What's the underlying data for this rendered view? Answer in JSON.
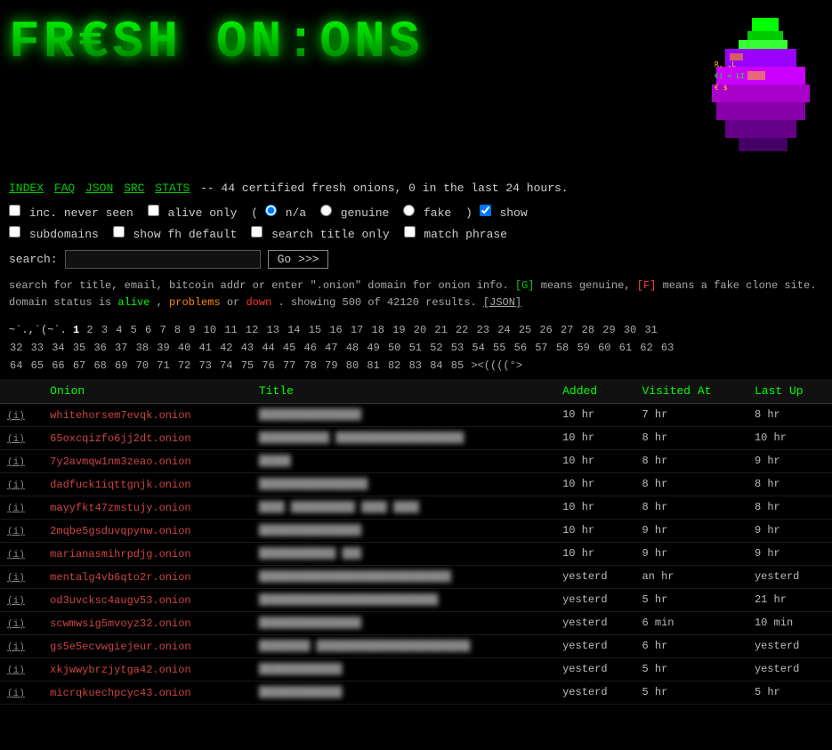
{
  "header": {
    "logo_text": "FR€SH ON:ONS",
    "nav": {
      "items": [
        {
          "label": "INDEX",
          "url": "#"
        },
        {
          "label": "FAQ",
          "url": "#"
        },
        {
          "label": "JSON",
          "url": "#"
        },
        {
          "label": "SRC",
          "url": "#"
        },
        {
          "label": "STATS",
          "url": "#"
        }
      ],
      "description": "-- 44 certified fresh onions, 0 in the last 24 hours."
    }
  },
  "options": {
    "inc_never_seen": {
      "label": "inc. never seen",
      "checked": false
    },
    "alive_only": {
      "label": "alive only",
      "checked": false
    },
    "radio_na": {
      "label": "n/a",
      "value": "na"
    },
    "radio_genuine": {
      "label": "genuine",
      "value": "genuine"
    },
    "radio_fake": {
      "label": "fake",
      "value": "fake"
    },
    "show": {
      "label": "show",
      "checked": true
    },
    "subdomains": {
      "label": "subdomains",
      "checked": false
    },
    "show_fh_default": {
      "label": "show fh default",
      "checked": false
    },
    "search_title_only": {
      "label": "search title only",
      "checked": false
    },
    "match_phrase": {
      "label": "match phrase",
      "checked": false
    }
  },
  "search": {
    "label": "search:",
    "placeholder": "",
    "button_label": "Go >>>"
  },
  "info": {
    "line1": "search for title, email, bitcoin addr or enter \".onion\" domain for onion info.",
    "genuine_marker": "[G]",
    "genuine_desc": "means genuine,",
    "fake_marker": "[F]",
    "fake_desc": "means a fake clone site. domain status is",
    "alive": "alive",
    "problems": "problems",
    "or": "or",
    "down": "down",
    "showing": ". showing 500 of 42120 results.",
    "json_link": "[JSON]"
  },
  "pagination": {
    "smile": "~`.,`(~`.",
    "current": "1",
    "pages": [
      "2",
      "3",
      "4",
      "5",
      "6",
      "7",
      "8",
      "9",
      "10",
      "11",
      "12",
      "13",
      "14",
      "15",
      "16",
      "17",
      "18",
      "19",
      "20",
      "21",
      "22",
      "23",
      "24",
      "25",
      "26",
      "27",
      "28",
      "29",
      "30",
      "31",
      "32",
      "33",
      "34",
      "35",
      "36",
      "37",
      "38",
      "39",
      "40",
      "41",
      "42",
      "43",
      "44",
      "45",
      "46",
      "47",
      "48",
      "49",
      "50",
      "51",
      "52",
      "53",
      "54",
      "55",
      "56",
      "57",
      "58",
      "59",
      "60",
      "61",
      "62",
      "63",
      "64",
      "65",
      "66",
      "67",
      "68",
      "69",
      "70",
      "71",
      "72",
      "73",
      "74",
      "75",
      "76",
      "77",
      "78",
      "79",
      "80",
      "81",
      "82",
      "83",
      "84",
      "85"
    ],
    "end_symbol": "><(((°>"
  },
  "table": {
    "headers": [
      "",
      "Onion",
      "Title",
      "Added",
      "Visited At",
      "Last Up"
    ],
    "rows": [
      {
        "i": "(i)",
        "onion": "whitehorsem7evqk.onion",
        "title": "",
        "added": "10 hr",
        "visited": "7 hr",
        "last_up": "8 hr",
        "blurred": true
      },
      {
        "i": "(i)",
        "onion": "65oxcqizfo6jj2dt.onion",
        "title": "",
        "added": "10 hr",
        "visited": "8 hr",
        "last_up": "10 hr",
        "blurred": true
      },
      {
        "i": "(i)",
        "onion": "7y2avmqw1nm3zeao.onion",
        "title": "",
        "added": "10 hr",
        "visited": "8 hr",
        "last_up": "9 hr",
        "blurred": true
      },
      {
        "i": "(i)",
        "onion": "dadfuck1iqttgnjk.onion",
        "title": "",
        "added": "10 hr",
        "visited": "8 hr",
        "last_up": "8 hr",
        "blurred": true
      },
      {
        "i": "(i)",
        "onion": "mayyfkt47zmstujy.onion",
        "title": "",
        "added": "10 hr",
        "visited": "8 hr",
        "last_up": "8 hr",
        "blurred": true
      },
      {
        "i": "(i)",
        "onion": "2mqbe5gsduvqpynw.onion",
        "title": "",
        "added": "10 hr",
        "visited": "9 hr",
        "last_up": "9 hr",
        "blurred": true
      },
      {
        "i": "(i)",
        "onion": "marianasmihrpdjg.onion",
        "title": "",
        "added": "10 hr",
        "visited": "9 hr",
        "last_up": "9 hr",
        "blurred": true
      },
      {
        "i": "(i)",
        "onion": "mentalg4vb6qto2r.onion",
        "title": "",
        "added": "yesterd",
        "visited": "an hr",
        "last_up": "yesterd",
        "blurred": true
      },
      {
        "i": "(i)",
        "onion": "od3uvcksc4augv53.onion",
        "title": "",
        "added": "yesterd",
        "visited": "5 hr",
        "last_up": "21 hr",
        "blurred": true
      },
      {
        "i": "(i)",
        "onion": "scwmwsig5mvoyz32.onion",
        "title": "",
        "added": "yesterd",
        "visited": "6 min",
        "last_up": "10 min",
        "blurred": true
      },
      {
        "i": "(i)",
        "onion": "gs5e5ecvwgiejeur.onion",
        "title": "",
        "added": "yesterd",
        "visited": "6 hr",
        "last_up": "yesterd",
        "blurred": true
      },
      {
        "i": "(i)",
        "onion": "xkjwwybrzjytga42.onion",
        "title": "",
        "added": "yesterd",
        "visited": "5 hr",
        "last_up": "yesterd",
        "blurred": true
      },
      {
        "i": "(i)",
        "onion": "micrqkuechpcyc43.onion",
        "title": "",
        "added": "yesterd",
        "visited": "5 hr",
        "last_up": "5 hr",
        "blurred": true
      }
    ]
  }
}
